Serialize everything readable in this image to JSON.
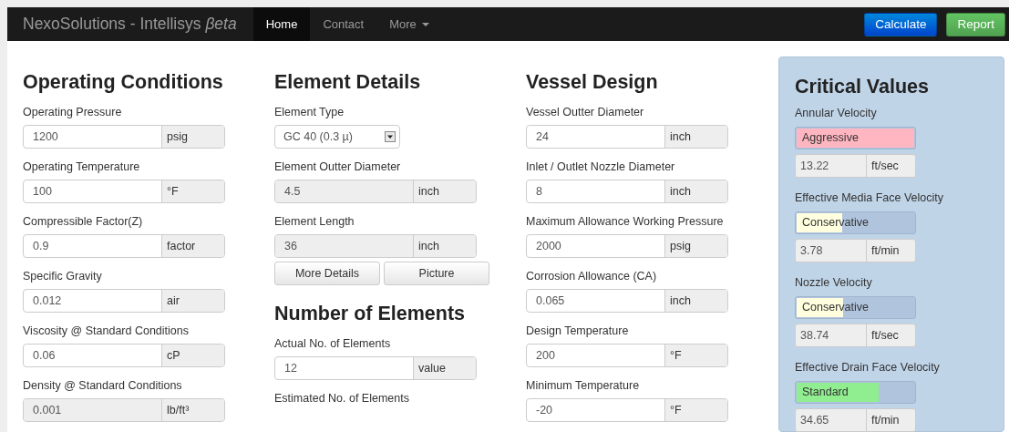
{
  "navbar": {
    "brand": "NexoSolutions - Intellisys *βeta*",
    "items": [
      {
        "label": "Home",
        "selected": true,
        "dropdown": false
      },
      {
        "label": "Contact",
        "selected": false,
        "dropdown": false
      },
      {
        "label": "More",
        "selected": false,
        "dropdown": true
      }
    ],
    "actions": [
      {
        "label": "Calculate",
        "kind": "primary"
      },
      {
        "label": "Report",
        "kind": "success"
      }
    ]
  },
  "columns": [
    {
      "sections": [
        {
          "title": "Operating Conditions",
          "items": [
            {
              "kind": "field",
              "label": "Operating Pressure",
              "value": "1200",
              "unit": "psig",
              "disabled": false
            },
            {
              "kind": "field",
              "label": "Operating Temperature",
              "value": "100",
              "unit": "°F",
              "disabled": false
            },
            {
              "kind": "field",
              "label": "Compressible Factor(Z)",
              "value": "0.9",
              "unit": "factor",
              "disabled": false
            },
            {
              "kind": "field",
              "label": "Specific Gravity",
              "value": "0.012",
              "unit": "air",
              "disabled": false
            },
            {
              "kind": "field",
              "label": "Viscosity @ Standard Conditions",
              "value": "0.06",
              "unit": "cP",
              "disabled": false
            },
            {
              "kind": "field",
              "label": "Density @ Standard Conditions",
              "value": "0.001",
              "unit": "lb/ft³",
              "disabled": true
            }
          ]
        }
      ]
    },
    {
      "sections": [
        {
          "title": "Element Details",
          "items": [
            {
              "kind": "select",
              "label": "Element Type",
              "value": "GC 40 (0.3 µ)"
            },
            {
              "kind": "field",
              "label": "Element Outter Diameter",
              "value": "4.5",
              "unit": "inch",
              "disabled": true
            },
            {
              "kind": "field",
              "label": "Element Length",
              "value": "36",
              "unit": "inch",
              "disabled": true
            },
            {
              "kind": "buttons",
              "buttons": [
                "More Details",
                "Picture"
              ]
            }
          ]
        },
        {
          "title": "Number of Elements",
          "items": [
            {
              "kind": "field",
              "label": "Actual No. of Elements",
              "value": "12",
              "unit": "value",
              "disabled": false
            },
            {
              "kind": "label",
              "label": "Estimated No. of Elements"
            }
          ]
        }
      ]
    },
    {
      "sections": [
        {
          "title": "Vessel Design",
          "items": [
            {
              "kind": "field",
              "label": "Vessel Outter Diameter",
              "value": "24",
              "unit": "inch",
              "disabled": false
            },
            {
              "kind": "field",
              "label": "Inlet / Outlet Nozzle Diameter",
              "value": "8",
              "unit": "inch",
              "disabled": false
            },
            {
              "kind": "field",
              "label": "Maximum Allowance Working Pressure",
              "value": "2000",
              "unit": "psig",
              "disabled": false
            },
            {
              "kind": "field",
              "label": "Corrosion Allowance (CA)",
              "value": "0.065",
              "unit": "inch",
              "disabled": false
            },
            {
              "kind": "field",
              "label": "Design Temperature",
              "value": "200",
              "unit": "°F",
              "disabled": false
            },
            {
              "kind": "field",
              "label": "Minimum Temperature",
              "value": "-20",
              "unit": "°F",
              "disabled": false
            }
          ]
        }
      ]
    }
  ],
  "critical": {
    "title": "Critical Values",
    "items": [
      {
        "label": "Annular Velocity",
        "rating": "Aggressive",
        "level": 1,
        "color": "#ffb6c1",
        "reading": "13.22",
        "unit": "ft/sec"
      },
      {
        "label": "Effective Media Face Velocity",
        "rating": "Conservative",
        "level": 0.38,
        "color": "#ffffe0",
        "reading": "3.78",
        "unit": "ft/min"
      },
      {
        "label": "Nozzle Velocity",
        "rating": "Conservative",
        "level": 0.39,
        "color": "#ffffe0",
        "reading": "38.74",
        "unit": "ft/sec"
      },
      {
        "label": "Effective Drain Face Velocity",
        "rating": "Standard",
        "level": 0.69,
        "color": "#90ee90",
        "reading": "34.65",
        "unit": "ft/min"
      }
    ]
  }
}
